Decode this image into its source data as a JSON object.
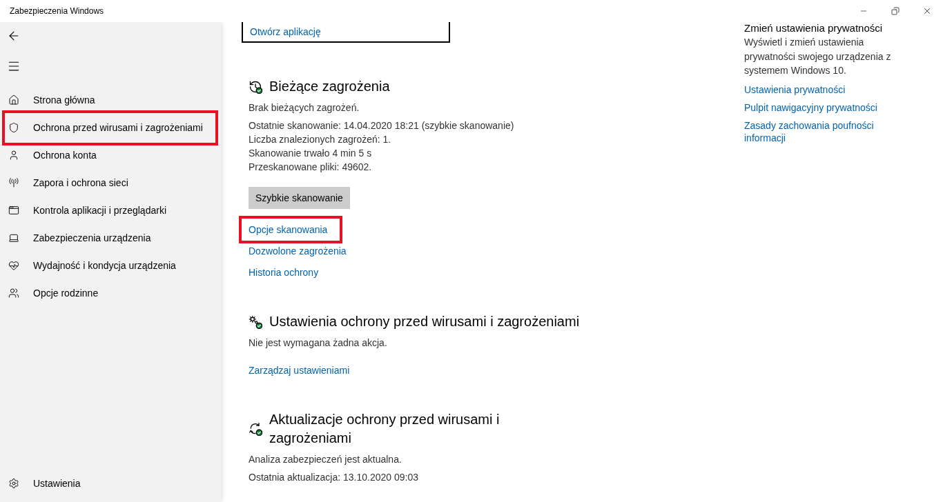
{
  "window": {
    "title": "Zabezpieczenia Windows"
  },
  "sidebar": {
    "items": [
      {
        "label": "Strona główna",
        "highlighted": false
      },
      {
        "label": "Ochrona przed wirusami i zagrożeniami",
        "highlighted": true
      },
      {
        "label": "Ochrona konta",
        "highlighted": false
      },
      {
        "label": "Zapora i ochrona sieci",
        "highlighted": false
      },
      {
        "label": "Kontrola aplikacji i przeglądarki",
        "highlighted": false
      },
      {
        "label": "Zabezpieczenia urządzenia",
        "highlighted": false
      },
      {
        "label": "Wydajność i kondycja urządzenia",
        "highlighted": false
      },
      {
        "label": "Opcje rodzinne",
        "highlighted": false
      }
    ],
    "footer_item": {
      "label": "Ustawienia"
    }
  },
  "main": {
    "card": {
      "link": "Otwórz aplikację"
    },
    "sections": [
      {
        "title": "Bieżące zagrożenia",
        "status": "Brak bieżących zagrożeń.",
        "details": [
          "Ostatnie skanowanie: 14.04.2020 18:21 (szybkie skanowanie)",
          "Liczba znalezionych zagrożeń: 1.",
          "Skanowanie trwało 4 min 5 s",
          "Przeskanowane pliki: 49602."
        ],
        "button": "Szybkie skanowanie",
        "links": [
          {
            "label": "Opcje skanowania",
            "highlighted": true
          },
          {
            "label": "Dozwolone zagrożenia",
            "highlighted": false
          },
          {
            "label": "Historia ochrony",
            "highlighted": false
          }
        ]
      },
      {
        "title": "Ustawienia ochrony przed wirusami i zagrożeniami",
        "status": "Nie jest wymagana żadna akcja.",
        "links": [
          {
            "label": "Zarządzaj ustawieniami",
            "highlighted": false
          }
        ]
      },
      {
        "title": "Aktualizacje ochrony przed wirusami i zagrożeniami",
        "status": "Analiza zabezpieczeń jest aktualna.",
        "details": [
          "Ostatnia aktualizacja: 13.10.2020 09:03"
        ]
      }
    ]
  },
  "side_panel": {
    "title": "Zmień ustawienia prywatności",
    "description": "Wyświetl i zmień ustawienia prywatności swojego urządzenia z systemem Windows 10.",
    "links": [
      "Ustawienia prywatności",
      "Pulpit nawigacyjny prywatności",
      "Zasady zachowania poufności informacji"
    ]
  }
}
